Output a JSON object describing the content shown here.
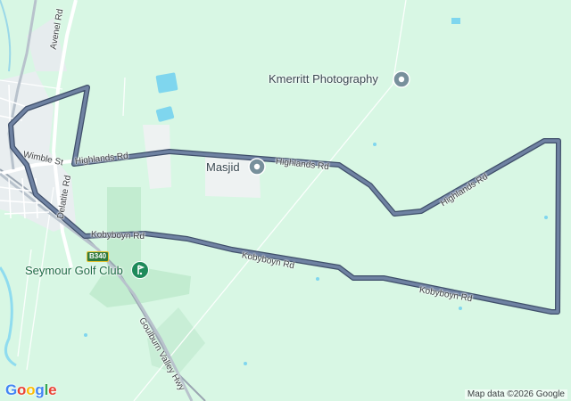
{
  "labels": {
    "avenel_rd": "Avenel Rd",
    "wimble_st": "Wimble St",
    "highlands_rd_west": "Highlands Rd",
    "highlands_rd_mid": "Highlands Rd",
    "highlands_rd_east": "Highlands Rd",
    "delatite_rd": "Delatite Rd",
    "kobyboyn_rd_west": "Kobyboyn Rd",
    "kobyboyn_rd_mid": "Kobyboyn Rd",
    "kobyboyn_rd_east": "Kobyboyn Rd",
    "goulburn_valley_hwy": "Goulburn Valley Hwy",
    "route_shield": "B340"
  },
  "places": {
    "kmerritt": "Kmerritt Photography",
    "masjid": "Masjid",
    "golf_club": "Seymour Golf Club"
  },
  "attribution": "Map data ©2026 Google",
  "logo": [
    "G",
    "o",
    "o",
    "g",
    "l",
    "e"
  ],
  "colors": {
    "background": "#d8f7e4",
    "route": "#5d6f8c",
    "route_outline": "#3f4f6a",
    "pin": "#78909c",
    "golf": "#1e8a5a",
    "water": "#7fd6ee"
  },
  "icons": {
    "poi_pin": "place-pin-icon",
    "golf_pin": "golf-flag-icon"
  }
}
